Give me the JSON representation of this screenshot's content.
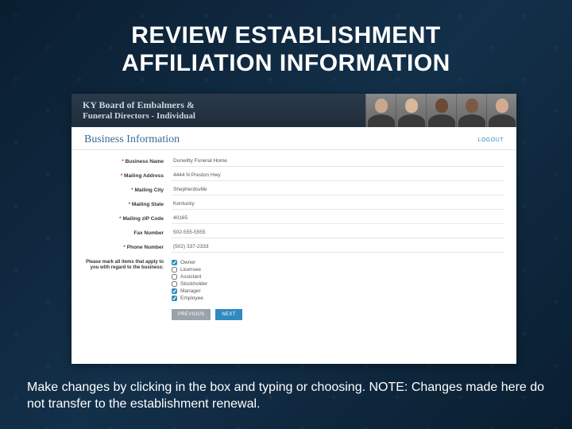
{
  "slide": {
    "title_line1": "REVIEW ESTABLISHMENT",
    "title_line2": "AFFILIATION INFORMATION",
    "caption": "Make changes by clicking in the box and typing or choosing.  NOTE: Changes made here do not transfer to the establishment renewal."
  },
  "app": {
    "brand_line1": "KY Board of Embalmers &",
    "brand_line2": "Funeral Directors - Individual",
    "section_title": "Business Information",
    "logout": "LOGOUT"
  },
  "fields": {
    "business_name": {
      "label": "Business Name",
      "value": "Dunwitty Funeral Home"
    },
    "mailing_address": {
      "label": "Mailing Address",
      "value": "4444 N Preston Hwy"
    },
    "mailing_city": {
      "label": "Mailing City",
      "value": "Shepherdsville"
    },
    "mailing_state": {
      "label": "Mailing State",
      "value": "Kentucky"
    },
    "mailing_zip": {
      "label": "Mailing zIP Code",
      "value": "40165"
    },
    "fax": {
      "label": "Fax Number",
      "value": "502-555-5555"
    },
    "phone": {
      "label": "Phone Number",
      "value": "(502) 337-2333"
    }
  },
  "checkbox_prompt": "Please mark all items that apply to you with regard to the business:",
  "checkboxes": [
    {
      "label": "Owner",
      "checked": true
    },
    {
      "label": "Licensee",
      "checked": false
    },
    {
      "label": "Assistant",
      "checked": false
    },
    {
      "label": "Stockholder",
      "checked": false
    },
    {
      "label": "Manager",
      "checked": true
    },
    {
      "label": "Employee",
      "checked": true
    }
  ],
  "buttons": {
    "prev": "PREVIOUS",
    "next": "NEXT"
  }
}
